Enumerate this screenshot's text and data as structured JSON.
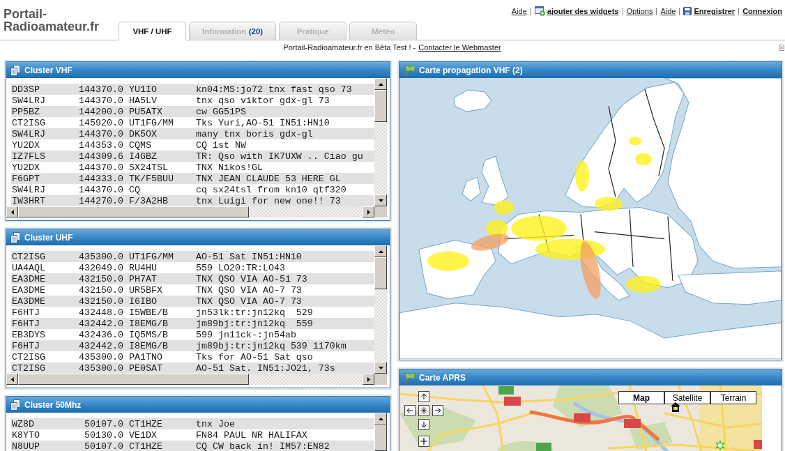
{
  "header": {
    "logo": "Portail-Radioamateur.fr"
  },
  "tabs": [
    {
      "label": "VHF / UHF",
      "selected": true
    },
    {
      "label": "Information",
      "count": "(20)",
      "selected": false
    },
    {
      "label": "Pratique",
      "selected": false
    },
    {
      "label": "Météo",
      "selected": false
    }
  ],
  "top_links": [
    {
      "label": "Aide",
      "kind": "plain",
      "bold": false
    },
    {
      "label": "ajouter des widgets",
      "kind": "add",
      "bold": true
    },
    {
      "label": "Options",
      "kind": "plain",
      "bold": false
    },
    {
      "label": "Aide",
      "kind": "plain",
      "bold": false
    },
    {
      "label": "Enregistrer",
      "kind": "save",
      "bold": true
    },
    {
      "label": "Connexion",
      "kind": "plain",
      "bold": true
    }
  ],
  "notice": {
    "text": "Portail-Radioamateur.fr en Bêta Test ! -",
    "link": "Contacter le Webmaster"
  },
  "left_column": [
    {
      "kind": "cluster",
      "title": "Cluster VHF",
      "rows": [
        [
          "DD3SP",
          "144370.0",
          "YU1IO",
          "kn04:MS:jo72 tnx fast qso 73"
        ],
        [
          "SW4LRJ",
          "144370.0",
          "HA5LV",
          "tnx qso viktor gdx-gl 73"
        ],
        [
          "PP5BZ",
          "144200.0",
          "PU5ATX",
          "cw GG51PS"
        ],
        [
          "CT2ISG",
          "145920.0",
          "UT1FG/MM",
          "Tks Yuri,AO-51 IN51:HN10"
        ],
        [
          "SW4LRJ",
          "144370.0",
          "DK5OX",
          "many tnx boris gdx-gl"
        ],
        [
          "YU2DX",
          "144353.0",
          "CQMS",
          "CQ 1st NW"
        ],
        [
          "IZ7FLS",
          "144309.6",
          "I4GBZ",
          "TR: Qso with IK7UXW .. Ciao gu"
        ],
        [
          "YU2DX",
          "144370.0",
          "SX24TSL",
          "TNX Nikos!GL"
        ],
        [
          "F6GPT",
          "144333.0",
          "TK/F5BUU",
          "TNX JEAN CLAUDE 53 HERE GL"
        ],
        [
          "SW4LRJ",
          "144370.0",
          "CQ",
          "cq sx24tsl from kn10 qtf320"
        ],
        [
          "IW3HRT",
          "144270.0",
          "F/3A2HB",
          "tnx Luigi for new one!! 73"
        ]
      ]
    },
    {
      "kind": "cluster",
      "title": "Cluster UHF",
      "rows": [
        [
          "CT2ISG",
          "435300.0",
          "UT1FG/MM",
          "AO-51 Sat IN51:HN10"
        ],
        [
          "UA4AQL",
          "432049.0",
          "RU4HU",
          "559 LO20:TR:LO43"
        ],
        [
          "EA3DME",
          "432150.0",
          "PH7AT",
          "TNX QSO VIA AO-51 73"
        ],
        [
          "EA3DME",
          "432150.0",
          "UR5BFX",
          "TNX QSO VIA AO-7 73"
        ],
        [
          "EA3DME",
          "432150.0",
          "I6IBO",
          "TNX QSO VIA AO-7 73"
        ],
        [
          "F6HTJ",
          "432448.0",
          "I5WBE/B",
          "jn53lk:tr:jn12kq  529"
        ],
        [
          "F6HTJ",
          "432442.0",
          "I8EMG/B",
          "jm89bj:tr:jn12kq  559"
        ],
        [
          "EB3DYS",
          "432436.0",
          "IQ5MS/B",
          "599 jn11ck-:jn54ab"
        ],
        [
          "F6HTJ",
          "432442.0",
          "I8EMG/B",
          "jm89bj:tr:jn12kq 539 1170km"
        ],
        [
          "CT2ISG",
          "435300.0",
          "PA1TNO",
          "Tks for AO-51 Sat qso"
        ],
        [
          "CT2ISG",
          "435300.0",
          "PE0SAT",
          "AO-51 Sat. IN51:JO21, 73s"
        ]
      ]
    },
    {
      "kind": "cluster",
      "title": "Cluster 50Mhz",
      "rows": [
        [
          "WZ8D",
          "50107.0",
          "CT1HZE",
          "tnx Joe"
        ],
        [
          "K8YTO",
          "50130.0",
          "VE1DX",
          "FN84 PAUL NR HALIFAX"
        ],
        [
          "N8UUP",
          "50107.0",
          "CT1HZE",
          "CQ CW back in! IM57:EN82"
        ]
      ]
    }
  ],
  "right_column": [
    {
      "kind": "propagation_map",
      "title": "Carte propagation VHF (2)"
    },
    {
      "kind": "aprs_map",
      "title": "Carte APRS",
      "map_types": [
        {
          "label": "Map",
          "selected": true
        },
        {
          "label": "Satellite",
          "selected": false
        },
        {
          "label": "Terrain",
          "selected": false
        }
      ]
    }
  ]
}
